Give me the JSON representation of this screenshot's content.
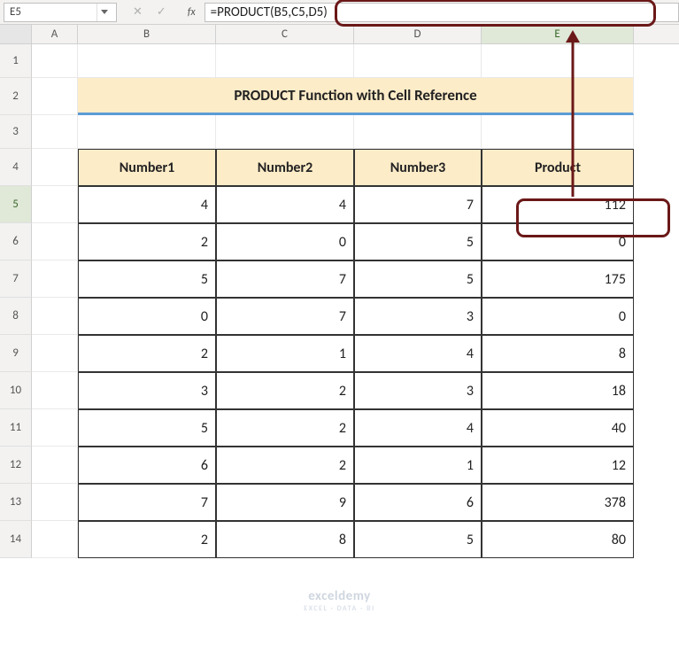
{
  "nameBox": "E5",
  "formula": "=PRODUCT(B5,C5,D5)",
  "columns": [
    "A",
    "B",
    "C",
    "D",
    "E"
  ],
  "rowNumbers": [
    "1",
    "2",
    "3",
    "4",
    "5",
    "6",
    "7",
    "8",
    "9",
    "10",
    "11",
    "12",
    "13",
    "14"
  ],
  "title": "PRODUCT Function with Cell Reference",
  "headers": {
    "b": "Number1",
    "c": "Number2",
    "d": "Number3",
    "e": "Product"
  },
  "rows": [
    {
      "b": "4",
      "c": "4",
      "d": "7",
      "e": "112"
    },
    {
      "b": "2",
      "c": "0",
      "d": "5",
      "e": "0"
    },
    {
      "b": "5",
      "c": "7",
      "d": "5",
      "e": "175"
    },
    {
      "b": "0",
      "c": "7",
      "d": "3",
      "e": "0"
    },
    {
      "b": "2",
      "c": "1",
      "d": "4",
      "e": "8"
    },
    {
      "b": "3",
      "c": "2",
      "d": "3",
      "e": "18"
    },
    {
      "b": "5",
      "c": "2",
      "d": "4",
      "e": "40"
    },
    {
      "b": "6",
      "c": "2",
      "d": "1",
      "e": "12"
    },
    {
      "b": "7",
      "c": "9",
      "d": "6",
      "e": "378"
    },
    {
      "b": "2",
      "c": "8",
      "d": "5",
      "e": "80"
    }
  ],
  "watermark": {
    "brand": "exceldemy",
    "tag": "EXCEL · DATA · BI"
  },
  "chart_data": {
    "type": "table",
    "title": "PRODUCT Function with Cell Reference",
    "columns": [
      "Number1",
      "Number2",
      "Number3",
      "Product"
    ],
    "data": [
      [
        4,
        4,
        7,
        112
      ],
      [
        2,
        0,
        5,
        0
      ],
      [
        5,
        7,
        5,
        175
      ],
      [
        0,
        7,
        3,
        0
      ],
      [
        2,
        1,
        4,
        8
      ],
      [
        3,
        2,
        3,
        18
      ],
      [
        5,
        2,
        4,
        40
      ],
      [
        6,
        2,
        1,
        12
      ],
      [
        7,
        9,
        6,
        378
      ],
      [
        2,
        8,
        5,
        80
      ]
    ]
  }
}
